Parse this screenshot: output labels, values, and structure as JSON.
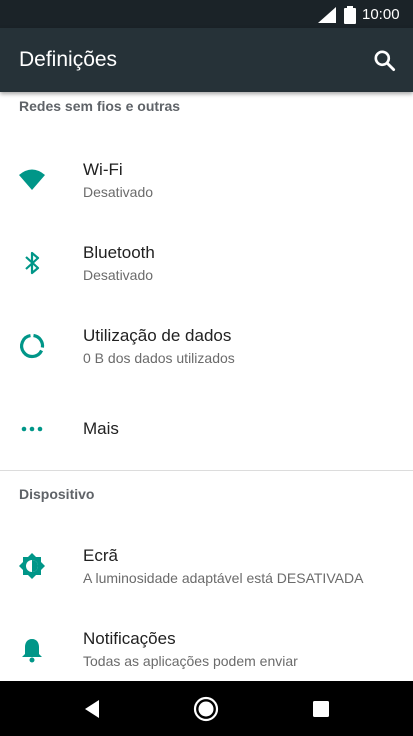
{
  "status_bar": {
    "time": "10:00",
    "icons": [
      "signal-icon",
      "battery-icon"
    ]
  },
  "app_bar": {
    "title": "Definições",
    "icons": [
      "search-icon"
    ]
  },
  "sections": [
    {
      "header": "Redes sem fios e outras",
      "items": [
        {
          "label": "Wi-Fi",
          "summary": "Desativado",
          "icon": "wifi-icon"
        },
        {
          "label": "Bluetooth",
          "summary": "Desativado",
          "icon": "bluetooth-icon"
        },
        {
          "label": "Utilização de dados",
          "summary": "0 B dos dados utilizados",
          "icon": "data-usage-icon"
        },
        {
          "label": "Mais",
          "summary": "",
          "icon": "more-icon"
        }
      ]
    },
    {
      "header": "Dispositivo",
      "items": [
        {
          "label": "Ecrã",
          "summary": "A luminosidade adaptável está DESATIVADA",
          "icon": "brightness-icon"
        },
        {
          "label": "Notificações",
          "summary": "Todas as aplicações podem enviar",
          "icon": "bell-icon"
        }
      ]
    }
  ],
  "nav_bar": {
    "icons": [
      "back-icon",
      "home-icon",
      "recents-icon"
    ]
  },
  "colors": {
    "status_bar": "#1b2328",
    "app_bar": "#263238",
    "accent": "#009688",
    "nav_bar": "#000000"
  }
}
